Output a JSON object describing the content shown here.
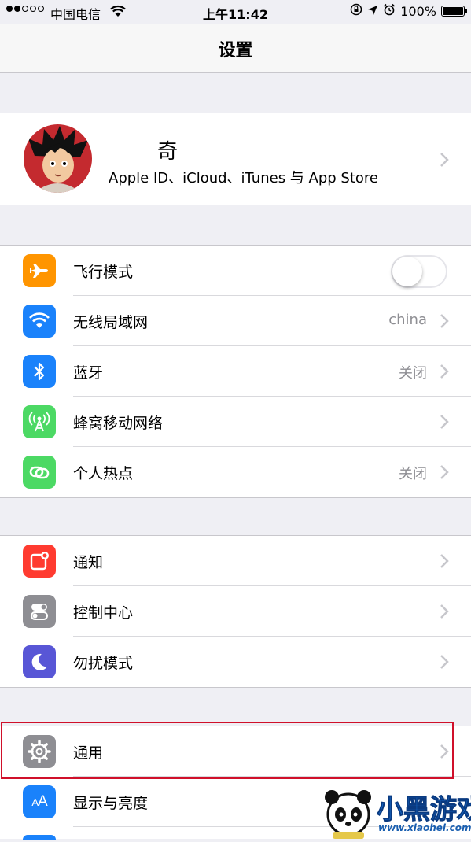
{
  "status_bar": {
    "carrier": "中国电信",
    "time": "上午11:42",
    "battery": "100%",
    "signal_strength": 2
  },
  "nav": {
    "title": "设置"
  },
  "profile": {
    "name": "奇",
    "subtitle": "Apple ID、iCloud、iTunes 与 App Store"
  },
  "connectivity": [
    {
      "label": "飞行模式",
      "icon": "airplane-icon",
      "color": "#ff9500",
      "toggle": false
    },
    {
      "label": "无线局域网",
      "icon": "wifi-icon",
      "color": "#1a82fb",
      "value": "china"
    },
    {
      "label": "蓝牙",
      "icon": "bluetooth-icon",
      "color": "#1a82fb",
      "value": "关闭"
    },
    {
      "label": "蜂窝移动网络",
      "icon": "cellular-icon",
      "color": "#4cd964"
    },
    {
      "label": "个人热点",
      "icon": "hotspot-icon",
      "color": "#4cd964",
      "value": "关闭"
    }
  ],
  "system": [
    {
      "label": "通知",
      "icon": "notifications-icon",
      "color": "#ff3b30"
    },
    {
      "label": "控制中心",
      "icon": "control-center-icon",
      "color": "#8e8e93"
    },
    {
      "label": "勿扰模式",
      "icon": "moon-icon",
      "color": "#5856d6"
    }
  ],
  "general": [
    {
      "label": "通用",
      "icon": "gear-icon",
      "color": "#8e8e93",
      "highlighted": true
    },
    {
      "label": "显示与亮度",
      "icon": "display-brightness-icon",
      "color": "#1a82fb"
    }
  ],
  "watermark": {
    "text": "小黑游戏",
    "url": "www.xiaohei.com"
  }
}
